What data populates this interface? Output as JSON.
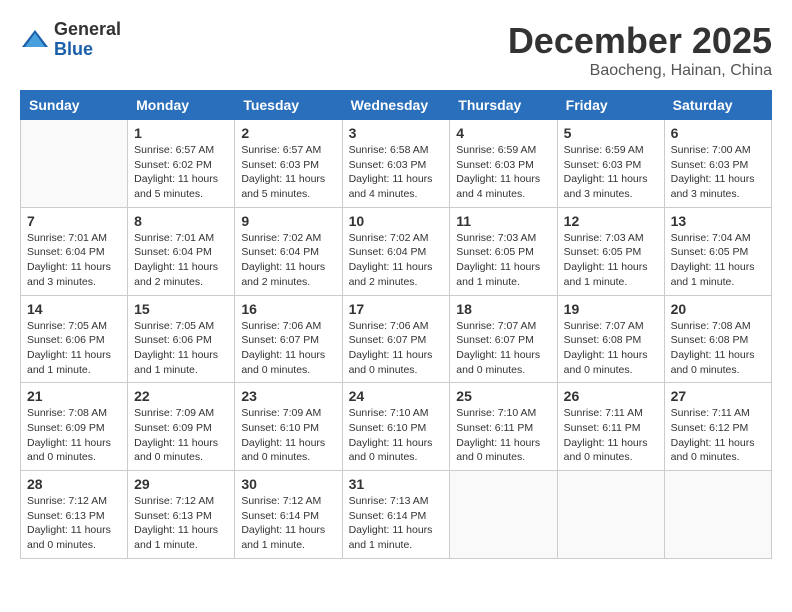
{
  "logo": {
    "general": "General",
    "blue": "Blue"
  },
  "title": {
    "month": "December 2025",
    "location": "Baocheng, Hainan, China"
  },
  "headers": [
    "Sunday",
    "Monday",
    "Tuesday",
    "Wednesday",
    "Thursday",
    "Friday",
    "Saturday"
  ],
  "weeks": [
    [
      {
        "day": "",
        "info": ""
      },
      {
        "day": "1",
        "info": "Sunrise: 6:57 AM\nSunset: 6:02 PM\nDaylight: 11 hours\nand 5 minutes."
      },
      {
        "day": "2",
        "info": "Sunrise: 6:57 AM\nSunset: 6:03 PM\nDaylight: 11 hours\nand 5 minutes."
      },
      {
        "day": "3",
        "info": "Sunrise: 6:58 AM\nSunset: 6:03 PM\nDaylight: 11 hours\nand 4 minutes."
      },
      {
        "day": "4",
        "info": "Sunrise: 6:59 AM\nSunset: 6:03 PM\nDaylight: 11 hours\nand 4 minutes."
      },
      {
        "day": "5",
        "info": "Sunrise: 6:59 AM\nSunset: 6:03 PM\nDaylight: 11 hours\nand 3 minutes."
      },
      {
        "day": "6",
        "info": "Sunrise: 7:00 AM\nSunset: 6:03 PM\nDaylight: 11 hours\nand 3 minutes."
      }
    ],
    [
      {
        "day": "7",
        "info": "Sunrise: 7:01 AM\nSunset: 6:04 PM\nDaylight: 11 hours\nand 3 minutes."
      },
      {
        "day": "8",
        "info": "Sunrise: 7:01 AM\nSunset: 6:04 PM\nDaylight: 11 hours\nand 2 minutes."
      },
      {
        "day": "9",
        "info": "Sunrise: 7:02 AM\nSunset: 6:04 PM\nDaylight: 11 hours\nand 2 minutes."
      },
      {
        "day": "10",
        "info": "Sunrise: 7:02 AM\nSunset: 6:04 PM\nDaylight: 11 hours\nand 2 minutes."
      },
      {
        "day": "11",
        "info": "Sunrise: 7:03 AM\nSunset: 6:05 PM\nDaylight: 11 hours\nand 1 minute."
      },
      {
        "day": "12",
        "info": "Sunrise: 7:03 AM\nSunset: 6:05 PM\nDaylight: 11 hours\nand 1 minute."
      },
      {
        "day": "13",
        "info": "Sunrise: 7:04 AM\nSunset: 6:05 PM\nDaylight: 11 hours\nand 1 minute."
      }
    ],
    [
      {
        "day": "14",
        "info": "Sunrise: 7:05 AM\nSunset: 6:06 PM\nDaylight: 11 hours\nand 1 minute."
      },
      {
        "day": "15",
        "info": "Sunrise: 7:05 AM\nSunset: 6:06 PM\nDaylight: 11 hours\nand 1 minute."
      },
      {
        "day": "16",
        "info": "Sunrise: 7:06 AM\nSunset: 6:07 PM\nDaylight: 11 hours\nand 0 minutes."
      },
      {
        "day": "17",
        "info": "Sunrise: 7:06 AM\nSunset: 6:07 PM\nDaylight: 11 hours\nand 0 minutes."
      },
      {
        "day": "18",
        "info": "Sunrise: 7:07 AM\nSunset: 6:07 PM\nDaylight: 11 hours\nand 0 minutes."
      },
      {
        "day": "19",
        "info": "Sunrise: 7:07 AM\nSunset: 6:08 PM\nDaylight: 11 hours\nand 0 minutes."
      },
      {
        "day": "20",
        "info": "Sunrise: 7:08 AM\nSunset: 6:08 PM\nDaylight: 11 hours\nand 0 minutes."
      }
    ],
    [
      {
        "day": "21",
        "info": "Sunrise: 7:08 AM\nSunset: 6:09 PM\nDaylight: 11 hours\nand 0 minutes."
      },
      {
        "day": "22",
        "info": "Sunrise: 7:09 AM\nSunset: 6:09 PM\nDaylight: 11 hours\nand 0 minutes."
      },
      {
        "day": "23",
        "info": "Sunrise: 7:09 AM\nSunset: 6:10 PM\nDaylight: 11 hours\nand 0 minutes."
      },
      {
        "day": "24",
        "info": "Sunrise: 7:10 AM\nSunset: 6:10 PM\nDaylight: 11 hours\nand 0 minutes."
      },
      {
        "day": "25",
        "info": "Sunrise: 7:10 AM\nSunset: 6:11 PM\nDaylight: 11 hours\nand 0 minutes."
      },
      {
        "day": "26",
        "info": "Sunrise: 7:11 AM\nSunset: 6:11 PM\nDaylight: 11 hours\nand 0 minutes."
      },
      {
        "day": "27",
        "info": "Sunrise: 7:11 AM\nSunset: 6:12 PM\nDaylight: 11 hours\nand 0 minutes."
      }
    ],
    [
      {
        "day": "28",
        "info": "Sunrise: 7:12 AM\nSunset: 6:13 PM\nDaylight: 11 hours\nand 0 minutes."
      },
      {
        "day": "29",
        "info": "Sunrise: 7:12 AM\nSunset: 6:13 PM\nDaylight: 11 hours\nand 1 minute."
      },
      {
        "day": "30",
        "info": "Sunrise: 7:12 AM\nSunset: 6:14 PM\nDaylight: 11 hours\nand 1 minute."
      },
      {
        "day": "31",
        "info": "Sunrise: 7:13 AM\nSunset: 6:14 PM\nDaylight: 11 hours\nand 1 minute."
      },
      {
        "day": "",
        "info": ""
      },
      {
        "day": "",
        "info": ""
      },
      {
        "day": "",
        "info": ""
      }
    ]
  ]
}
